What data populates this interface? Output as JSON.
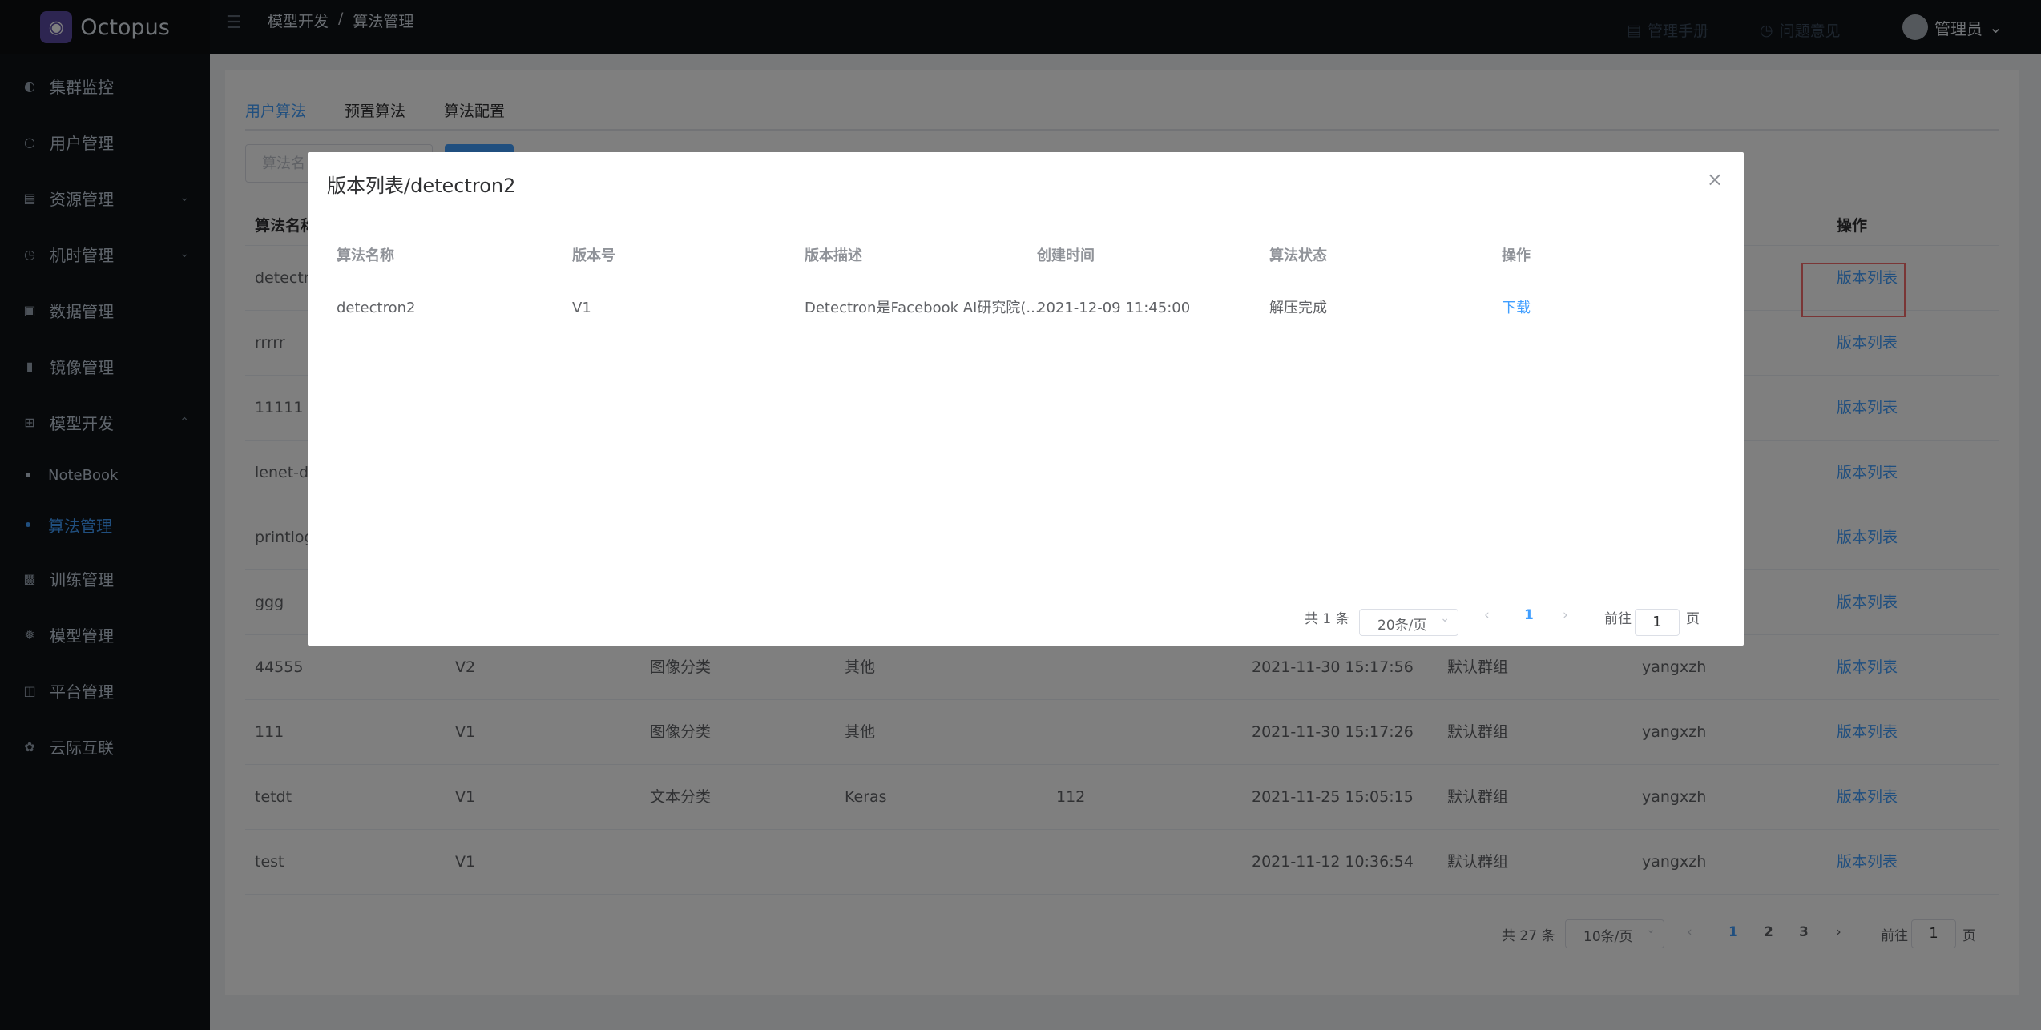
{
  "app": {
    "name": "Octopus"
  },
  "breadcrumb": {
    "parent": "模型开发",
    "separator": "/",
    "current": "算法管理"
  },
  "header": {
    "manual": "管理手册",
    "feedback": "问题意见",
    "user": "管理员"
  },
  "sidebar": {
    "items": [
      {
        "label": "集群监控",
        "icon": "dashboard-icon"
      },
      {
        "label": "用户管理",
        "icon": "user-icon"
      },
      {
        "label": "资源管理",
        "icon": "clipboard-icon"
      },
      {
        "label": "机时管理",
        "icon": "clock-icon"
      },
      {
        "label": "数据管理",
        "icon": "database-icon"
      },
      {
        "label": "镜像管理",
        "icon": "image-icon"
      },
      {
        "label": "模型开发",
        "icon": "grid-icon"
      },
      {
        "label": "NoteBook"
      },
      {
        "label": "算法管理"
      },
      {
        "label": "训练管理",
        "icon": "document-icon"
      },
      {
        "label": "模型管理",
        "icon": "settings-icon"
      },
      {
        "label": "平台管理",
        "icon": "monitor-icon"
      },
      {
        "label": "云际互联",
        "icon": "globe-icon"
      }
    ]
  },
  "tabs": [
    "用户算法",
    "预置算法",
    "算法配置"
  ],
  "search": {
    "placeholder": "算法名"
  },
  "table": {
    "headers": {
      "name": "算法名称",
      "op": "操作"
    },
    "rows": [
      {
        "c1": "detectro",
        "c2": "",
        "c3": "",
        "c4": "",
        "c5": "",
        "c6": "",
        "c7": "",
        "c8": "",
        "op": "版本列表"
      },
      {
        "c1": "rrrrr",
        "c2": "",
        "c3": "",
        "c4": "",
        "c5": "",
        "c6": "",
        "c7": "",
        "c8": "",
        "op": "版本列表"
      },
      {
        "c1": "11111",
        "c2": "",
        "c3": "",
        "c4": "",
        "c5": "",
        "c6": "",
        "c7": "",
        "c8": "",
        "op": "版本列表"
      },
      {
        "c1": "lenet-di",
        "c2": "",
        "c3": "",
        "c4": "",
        "c5": "",
        "c6": "",
        "c7": "",
        "c8": "",
        "op": "版本列表"
      },
      {
        "c1": "printlog",
        "c2": "",
        "c3": "",
        "c4": "",
        "c5": "",
        "c6": "",
        "c7": "",
        "c8": "",
        "op": "版本列表"
      },
      {
        "c1": "ggg",
        "c2": "",
        "c3": "",
        "c4": "",
        "c5": "",
        "c6": "",
        "c7": "",
        "c8": "",
        "op": "版本列表"
      },
      {
        "c1": "44555",
        "c2": "V2",
        "c3": "图像分类",
        "c4": "其他",
        "c5": "",
        "c6": "2021-11-30 15:17:56",
        "c7": "默认群组",
        "c8": "yangxzh",
        "op": "版本列表"
      },
      {
        "c1": "111",
        "c2": "V1",
        "c3": "图像分类",
        "c4": "其他",
        "c5": "",
        "c6": "2021-11-30 15:17:26",
        "c7": "默认群组",
        "c8": "yangxzh",
        "op": "版本列表"
      },
      {
        "c1": "tetdt",
        "c2": "V1",
        "c3": "文本分类",
        "c4": "Keras",
        "c5": "112",
        "c6": "2021-11-25 15:05:15",
        "c7": "默认群组",
        "c8": "yangxzh",
        "op": "版本列表"
      },
      {
        "c1": "test",
        "c2": "V1",
        "c3": "",
        "c4": "",
        "c5": "",
        "c6": "2021-11-12 10:36:54",
        "c7": "默认群组",
        "c8": "yangxzh",
        "op": "版本列表"
      }
    ]
  },
  "pagination": {
    "total": "共 27 条",
    "page_size": "10条/页",
    "pages": [
      "1",
      "2",
      "3"
    ],
    "goto_label": "前往",
    "goto_value": "1",
    "page_suffix": "页"
  },
  "dialog": {
    "title": "版本列表/detectron2",
    "headers": [
      "算法名称",
      "版本号",
      "版本描述",
      "创建时间",
      "算法状态",
      "操作"
    ],
    "row": {
      "name": "detectron2",
      "version": "V1",
      "desc": "Detectron是Facebook AI研究院(...",
      "time": "2021-12-09 11:45:00",
      "status": "解压完成",
      "action": "下载"
    },
    "pagination": {
      "total": "共 1 条",
      "page_size": "20条/页",
      "page": "1",
      "goto_label": "前往",
      "goto_value": "1",
      "page_suffix": "页"
    }
  },
  "colors": {
    "accent": "#409eff",
    "sidebar": "#0f1216",
    "highlight": "#f56c6c"
  }
}
